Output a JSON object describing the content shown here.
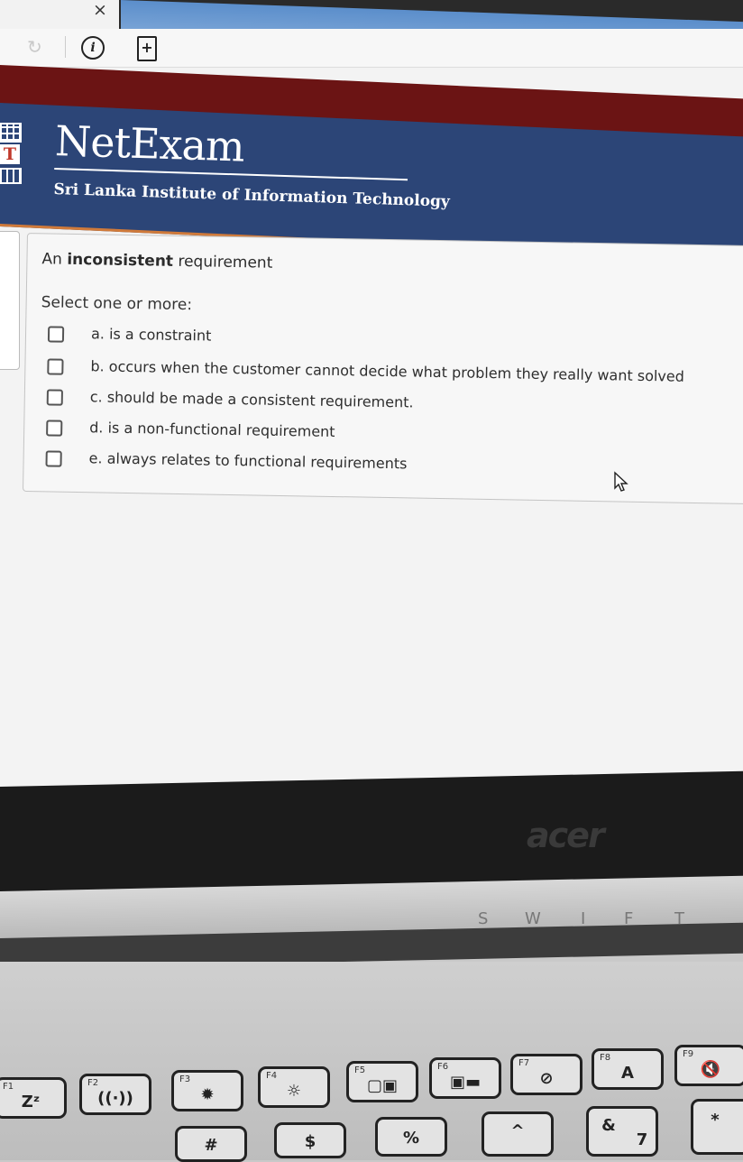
{
  "browser": {
    "close_glyph": "×",
    "reload_glyph": "↻",
    "info_glyph": "i",
    "page_glyph": "+"
  },
  "header": {
    "title": "NetExam",
    "subtitle": "Sri Lanka Institute of Information Technology",
    "logo_letter": "T",
    "banner_color": "#2c4577",
    "stripe_color": "#6b1414",
    "accent_color": "#d07a3a"
  },
  "question": {
    "text_before": "An ",
    "text_bold": "inconsistent",
    "text_after": " requirement",
    "prompt": "Select one or more:",
    "options": [
      {
        "label": "a. is a constraint",
        "checked": false
      },
      {
        "label": "b. occurs when the customer cannot decide what problem they really want solved",
        "checked": false
      },
      {
        "label": "c. should be made a consistent requirement.",
        "checked": false
      },
      {
        "label": "d. is a non-functional requirement",
        "checked": false
      },
      {
        "label": "e. always relates to functional requirements",
        "checked": false
      }
    ]
  },
  "laptop": {
    "brand": "acer",
    "model_letters": [
      "S",
      "W",
      "I",
      "F",
      "T"
    ],
    "keys": [
      {
        "fn": "F1",
        "glyph": "Zᶻ"
      },
      {
        "fn": "F2",
        "glyph": "((·))"
      },
      {
        "fn": "F3",
        "glyph": "✹"
      },
      {
        "fn": "F4",
        "glyph": "☼"
      },
      {
        "fn": "F5",
        "glyph": "▢▣"
      },
      {
        "fn": "F6",
        "glyph": "▣▬"
      },
      {
        "fn": "F7",
        "glyph": "⊘"
      },
      {
        "fn": "F8",
        "glyph": "A"
      },
      {
        "fn": "F9",
        "glyph": "🔇"
      }
    ],
    "row2_glyphs": [
      "#",
      "$",
      "%",
      "^",
      "&",
      "7",
      "*"
    ]
  }
}
